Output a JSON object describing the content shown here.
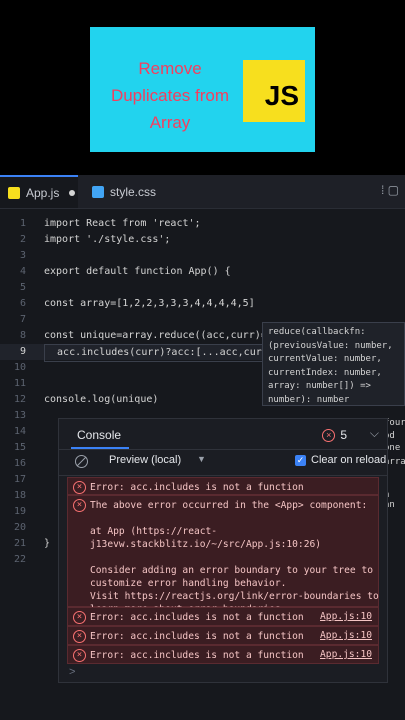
{
  "banner": {
    "title_lines": [
      "Remove",
      "Duplicates from",
      "Array"
    ],
    "logo": "JS"
  },
  "tabs": [
    {
      "label": "App.js",
      "icon": "js-file-icon"
    },
    {
      "label": "style.css",
      "icon": "css-file-icon"
    }
  ],
  "code": {
    "lines": [
      "import React from 'react';",
      "import './style.css';",
      "",
      "export default function App() {",
      "",
      "const array=[1,2,2,3,3,3,4,4,4,4,5]",
      "",
      "const unique=array.reduce((acc,curr)=>(",
      "  acc.includes(curr)?acc:[...acc,curr]",
      "",
      "",
      "console.log(unique)",
      "",
      "",
      "",
      "",
      "",
      "",
      "",
      "",
      "}",
      ""
    ],
    "current_line": 9
  },
  "tooltip": {
    "lines": [
      "reduce(callbackfn:",
      "(previousValue: number,",
      "currentValue: number,",
      "currentIndex: number,",
      "array: number[]) =>",
      "number): number"
    ]
  },
  "side_fragments": [
    "four",
    "od",
    "one",
    "array",
    "n an"
  ],
  "console": {
    "title": "Console",
    "error_count": "5",
    "preview_label": "Preview (local)",
    "clear_label": "Clear on reload",
    "messages": [
      {
        "text": "Error: acc.includes is not a function",
        "link": ""
      },
      {
        "text": "The above error occurred in the <App> component:\n\nat App (https://react-\nj13evw.stackblitz.io/~/src/App.js:10:26)\n\nConsider adding an error boundary to your tree to\ncustomize error handling behavior.\nVisit https://reactjs.org/link/error-boundaries to\nlearn more about error boundaries.",
        "link": ""
      },
      {
        "text": "Error: acc.includes is not a function",
        "link": "App.js:10"
      },
      {
        "text": "Error: acc.includes is not a function",
        "link": "App.js:10"
      },
      {
        "text": "Error: acc.includes is not a function",
        "link": "App.js:10"
      }
    ],
    "prompt": ">"
  }
}
